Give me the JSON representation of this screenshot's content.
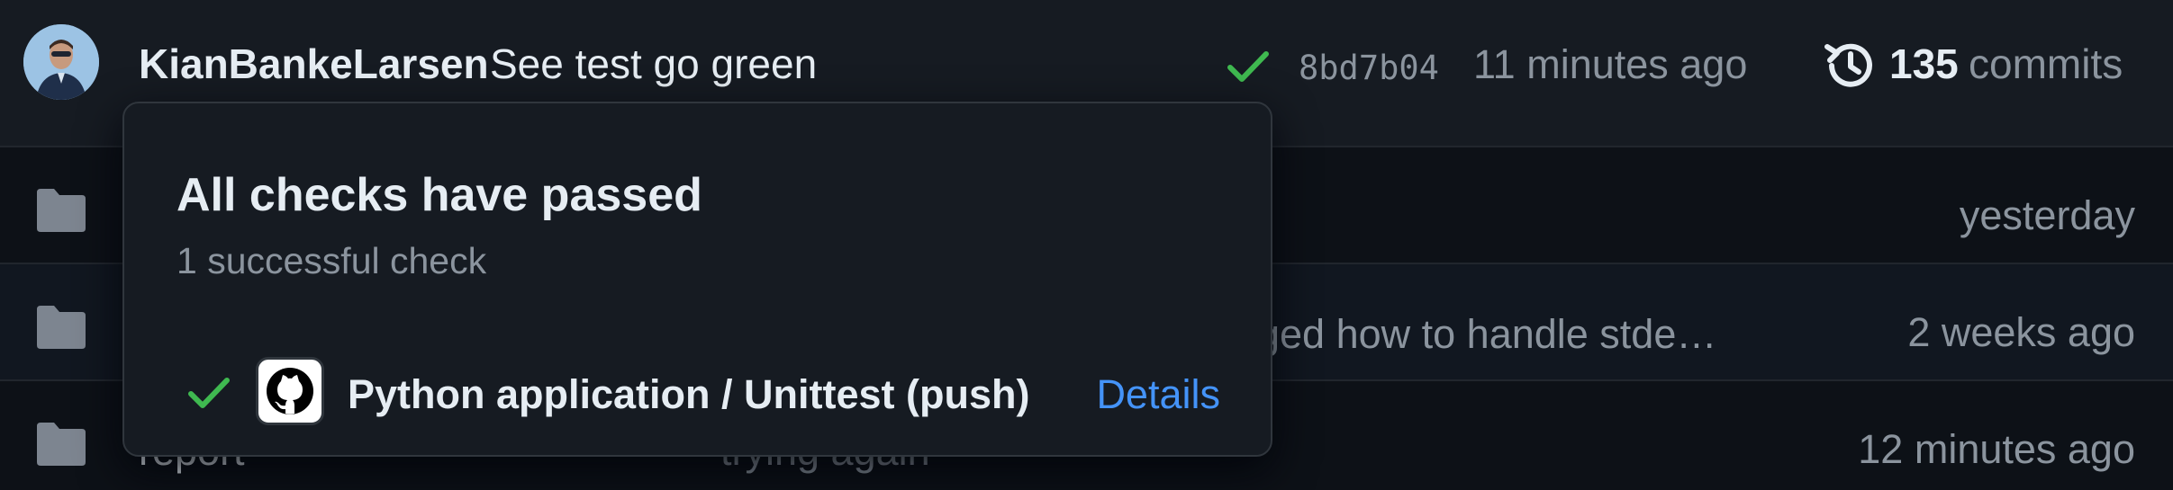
{
  "commit": {
    "author": "KianBankeLarsen",
    "message": "See test go green",
    "sha": "8bd7b04",
    "time": "11 minutes ago",
    "count": "135",
    "count_label": "commits",
    "status_icon": "check-icon",
    "history_icon": "history-icon"
  },
  "files": [
    {
      "icon": "folder-icon",
      "name": "",
      "message": "",
      "time": "yesterday"
    },
    {
      "icon": "folder-icon",
      "name": "",
      "message": "ged how to handle stde…",
      "time": "2 weeks ago"
    },
    {
      "icon": "folder-icon",
      "name": "report",
      "message": "trying again",
      "time": "12 minutes ago"
    }
  ],
  "popover": {
    "title": "All checks have passed",
    "subtitle": "1 successful check",
    "checks": [
      {
        "status_icon": "check-icon",
        "app_icon": "github-logo-icon",
        "label": "Python application / Unittest (push)",
        "details_label": "Details"
      }
    ]
  },
  "colors": {
    "success": "#3fb950",
    "link": "#4493f8",
    "muted": "#8b949e",
    "text": "#e6edf3",
    "background": "#0d1117",
    "surface": "#161b22",
    "border": "#30363d"
  }
}
